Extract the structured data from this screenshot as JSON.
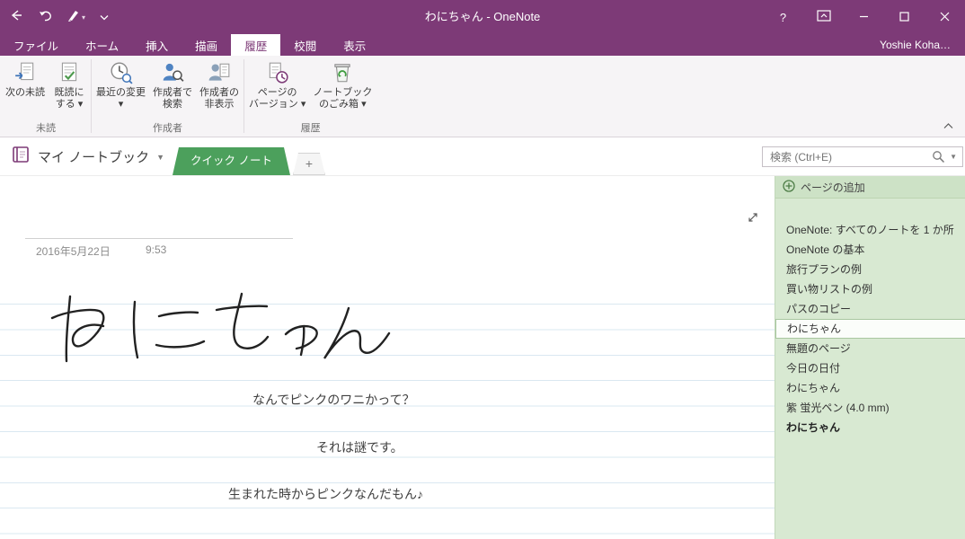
{
  "colors": {
    "accent": "#7d3a77",
    "section_green": "#4ca05c",
    "sidebar_bg": "#d8e9d2",
    "sidebar_header_bg": "#cde2c6",
    "ruled_line": "#dae8f1",
    "ribbon_bg": "#f6f4f6"
  },
  "titlebar": {
    "title": "わにちゃん - OneNote",
    "help": "?"
  },
  "menu": {
    "tabs": [
      "ファイル",
      "ホーム",
      "挿入",
      "描画",
      "履歴",
      "校閲",
      "表示"
    ],
    "active_tab": "履歴",
    "account": "Yoshie Koha…"
  },
  "ribbon": {
    "groups": [
      {
        "label": "未読",
        "buttons": [
          {
            "label": "次の未読",
            "icon": "next-unread-icon"
          },
          {
            "label": "既読に\nする ▾",
            "icon": "mark-read-icon"
          }
        ]
      },
      {
        "label": "作成者",
        "buttons": [
          {
            "label": "最近の変更\n▾",
            "icon": "recent-changes-icon"
          },
          {
            "label": "作成者で\n検索",
            "icon": "search-author-icon"
          },
          {
            "label": "作成者の\n非表示",
            "icon": "hide-authors-icon"
          }
        ]
      },
      {
        "label": "履歴",
        "buttons": [
          {
            "label": "ページの\nバージョン ▾",
            "icon": "page-versions-icon"
          },
          {
            "label": "ノートブック\nのごみ箱 ▾",
            "icon": "recycle-bin-icon"
          }
        ]
      }
    ]
  },
  "navbar": {
    "notebook_label": "マイ ノートブック",
    "section_tabs": [
      {
        "label": "クイック ノート",
        "active": true
      }
    ],
    "add_section": "+",
    "search": {
      "placeholder": "検索 (Ctrl+E)"
    }
  },
  "page": {
    "date": "2016年5月22日",
    "time": "9:53",
    "ink_text": "わにちゃん",
    "paragraphs": [
      "なんでピンクのワニかって？",
      "それは謎です。",
      "生まれた時からピンクなんだもん♪"
    ]
  },
  "sidebar": {
    "header": "ページの追加",
    "pages": [
      {
        "label": "OneNote: すべてのノートを 1 か所"
      },
      {
        "label": "OneNote の基本"
      },
      {
        "label": "旅行プランの例"
      },
      {
        "label": "買い物リストの例"
      },
      {
        "label": "パスのコピー"
      },
      {
        "label": "わにちゃん",
        "selected": true
      },
      {
        "label": "無題のページ"
      },
      {
        "label": "今日の日付"
      },
      {
        "label": "わにちゃん"
      },
      {
        "label": "紫 蛍光ペン (4.0 mm)"
      },
      {
        "label": "わにちゃん",
        "bold": true
      }
    ]
  }
}
